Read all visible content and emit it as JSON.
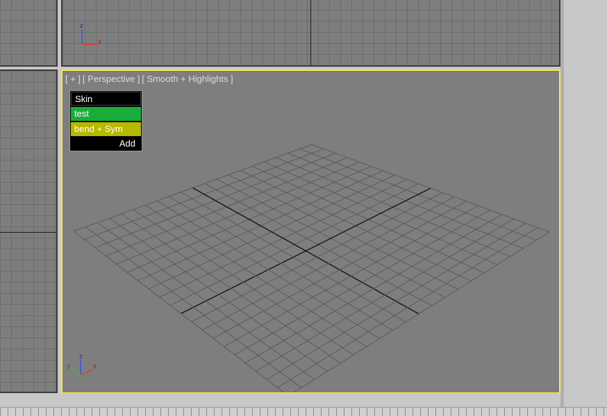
{
  "viewports": {
    "perspective": {
      "label_plus": "[ + ]",
      "label_view": "[ Perspective ]",
      "label_shading": "[ Smooth + Highlights ]"
    }
  },
  "nav_panel": {
    "items": [
      {
        "label": "Skin",
        "color": "#000000"
      },
      {
        "label": "test",
        "color": "#1aad3a"
      },
      {
        "label": "bend + Sym",
        "color": "#b7b800"
      }
    ],
    "add_label": "Add"
  },
  "axis_gizmo": {
    "x": "x",
    "y": "y",
    "z": "z"
  },
  "colors": {
    "active_border": "#ffe84a",
    "viewport_bg": "#7e7e7e",
    "axis_x": "#e03a3a",
    "axis_y": "#4ab34a",
    "axis_z": "#3a5ad6"
  }
}
